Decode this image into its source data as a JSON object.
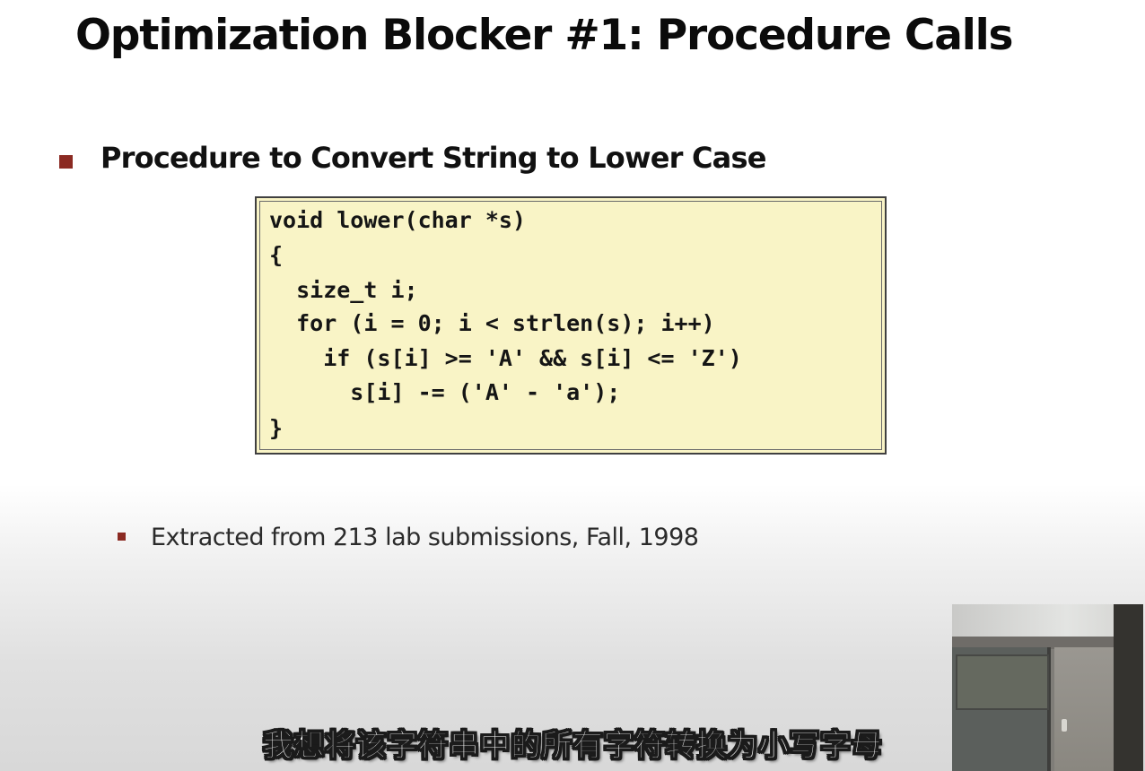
{
  "slide": {
    "title": "Optimization Blocker #1: Procedure Calls",
    "bullet": "Procedure to Convert String to Lower Case",
    "code_lines": [
      "void lower(char *s)",
      "{",
      "  size_t i;",
      "  for (i = 0; i < strlen(s); i++)",
      "    if (s[i] >= 'A' && s[i] <= 'Z')",
      "      s[i] -= ('A' - 'a');",
      "}"
    ],
    "sub_bullet": "Extracted from 213 lab submissions, Fall, 1998"
  },
  "video": {
    "subtitle": "我想将该字符串中的所有字符转换为小写字母"
  },
  "colors": {
    "bullet": "#8b2a22",
    "code_background": "#f9f4c6"
  }
}
